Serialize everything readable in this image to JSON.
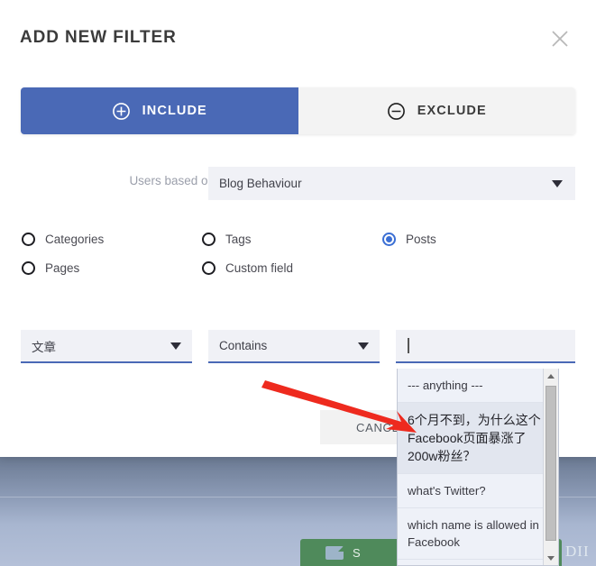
{
  "modal": {
    "title": "ADD NEW FILTER",
    "close_icon": "close-icon"
  },
  "segmented": {
    "include": {
      "label": "INCLUDE",
      "icon": "plus-circle-icon",
      "active": true
    },
    "exclude": {
      "label": "EXCLUDE",
      "icon": "minus-circle-icon",
      "active": false
    }
  },
  "users_based_on": {
    "label": "Users based on",
    "value": "Blog Behaviour",
    "caret_icon": "chevron-down-icon"
  },
  "radios": {
    "row1": [
      {
        "label": "Categories",
        "checked": false
      },
      {
        "label": "Tags",
        "checked": false
      },
      {
        "label": "Posts",
        "checked": true
      }
    ],
    "row2": [
      {
        "label": "Pages",
        "checked": false
      },
      {
        "label": "Custom field",
        "checked": false
      }
    ]
  },
  "condition": {
    "field_select": {
      "value": "文章",
      "caret_icon": "chevron-down-icon"
    },
    "operator_select": {
      "value": "Contains",
      "caret_icon": "chevron-down-icon"
    },
    "value_input": {
      "value": "",
      "placeholder": ""
    }
  },
  "suggestions": {
    "items": [
      {
        "label": "--- anything ---",
        "highlighted": false
      },
      {
        "label": "6个月不到，为什么这个Facebook页面暴涨了200w粉丝？",
        "highlighted": true
      },
      {
        "label": "what's Twitter?",
        "highlighted": false
      },
      {
        "label": "which name is allowed in Facebook",
        "highlighted": false
      }
    ],
    "scrollbar": {
      "up_icon": "scroll-up-arrow-icon",
      "down_icon": "scroll-down-arrow-icon"
    }
  },
  "footer": {
    "cancel_label": "CANCEL"
  },
  "background": {
    "green_button_label": "S",
    "green_button_icon": "save-disk-icon",
    "right_text": "DII"
  },
  "annotation": {
    "arrow_color": "#ee2a1e",
    "arrow_name": "red-pointer-arrow"
  },
  "colors": {
    "accent_blue": "#4a69b6",
    "radio_selected": "#3b6fd4",
    "field_bg": "#f0f1f6",
    "inactive_tab_bg": "#f3f3f3",
    "green_button": "#4f8a5b",
    "annotation_red": "#ee2a1e"
  }
}
